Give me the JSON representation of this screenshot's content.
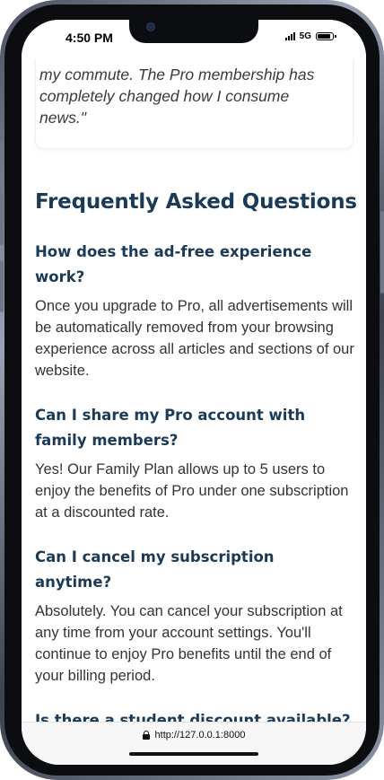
{
  "status_bar": {
    "time": "4:50 PM",
    "network": "5G",
    "icons": [
      "signal-icon",
      "battery-icon"
    ]
  },
  "testimonial": {
    "text_visible": "my commute. The Pro membership has completely changed how I consume news.\""
  },
  "faq": {
    "title": "Frequently Asked Questions",
    "items": [
      {
        "question": "How does the ad-free experience work?",
        "answer": "Once you upgrade to Pro, all advertisements will be automatically removed from your browsing experience across all articles and sections of our website."
      },
      {
        "question": "Can I share my Pro account with family members?",
        "answer": "Yes! Our Family Plan allows up to 5 users to enjoy the benefits of Pro under one subscription at a discounted rate."
      },
      {
        "question": "Can I cancel my subscription anytime?",
        "answer": "Absolutely. You can cancel your subscription at any time from your account settings. You'll continue to enjoy Pro benefits until the end of your billing period."
      },
      {
        "question": "Is there a student discount available?",
        "answer": ""
      }
    ]
  },
  "browser": {
    "url": "http://127.0.0.1:8000",
    "icon": "lock-icon"
  },
  "colors": {
    "heading": "#1b3a56",
    "body_text": "#333333",
    "frame": "#0c0d10"
  }
}
